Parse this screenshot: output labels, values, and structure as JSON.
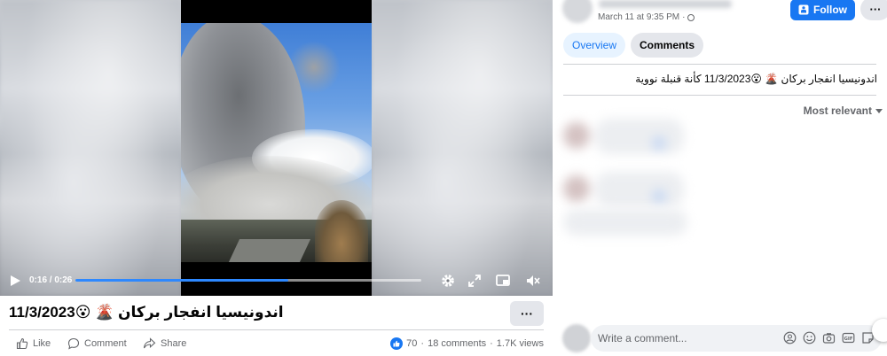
{
  "video": {
    "time_display": "0:16 / 0:26",
    "progress_fraction": 0.615
  },
  "post": {
    "title": "اندونيسيا انفجار بركان 🌋 😮11/3/2023",
    "actions": {
      "like_label": "Like",
      "comment_label": "Comment",
      "share_label": "Share"
    },
    "stats": {
      "reactions_count": "70",
      "separator1": "·",
      "comments": "18 comments",
      "separator2": "·",
      "views": "1.7K views"
    }
  },
  "sidebar": {
    "timestamp": "March 11 at 9:35 PM",
    "separator": "·",
    "follow_label": "Follow",
    "tabs": [
      {
        "label": "Overview",
        "active": false
      },
      {
        "label": "Comments",
        "active": true
      }
    ],
    "caption": "اندونيسيا انفجار بركان 🌋 😮11/3/2023 كأنة قنبلة نووية",
    "sort_label": "Most relevant",
    "composer_placeholder": "Write a comment..."
  },
  "colors": {
    "accent": "#1877f2",
    "tab_active_bg": "#e7f3ff",
    "button_gray": "#e4e6eb"
  }
}
